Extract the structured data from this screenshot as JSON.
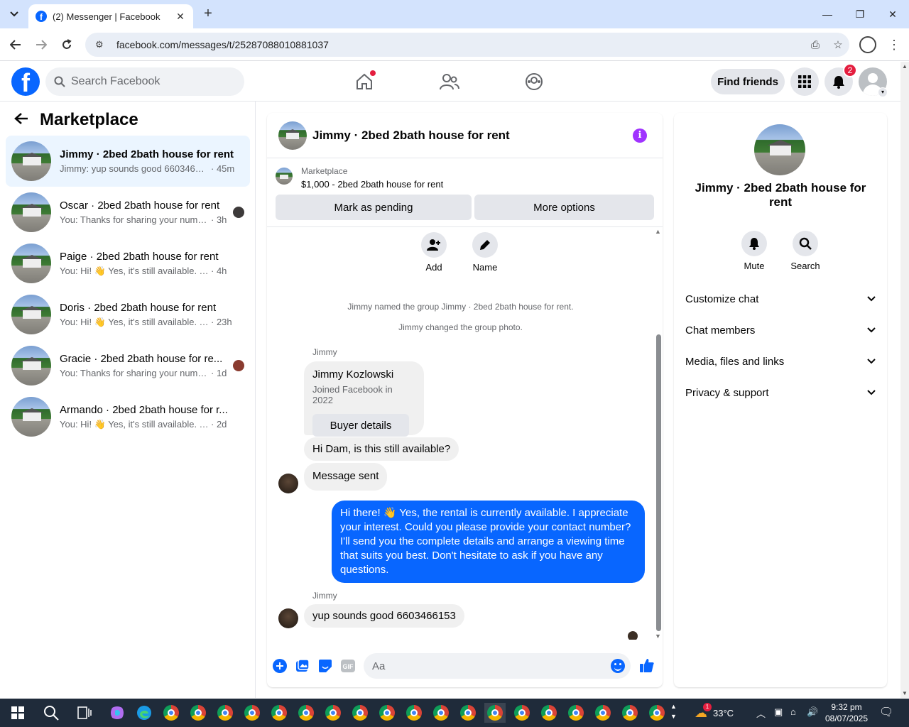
{
  "browser": {
    "tab_title": "(2) Messenger | Facebook",
    "url": "facebook.com/messages/t/25287088010881037"
  },
  "fb": {
    "search_placeholder": "Search Facebook",
    "find_friends": "Find friends",
    "notification_count": "2"
  },
  "left": {
    "title": "Marketplace",
    "conversations": [
      {
        "name": "Jimmy · 2bed 2bath house for rent",
        "snippet": "Jimmy: yup sounds good 66034661...",
        "time": "· 45m",
        "active": true
      },
      {
        "name": "Oscar · 2bed 2bath house for rent",
        "snippet": "You: Thanks for sharing your numb...",
        "time": "· 3h"
      },
      {
        "name": "Paige · 2bed 2bath house for rent",
        "snippet": "You: Hi! 👋 Yes, it's still available. Tha...",
        "time": "· 4h"
      },
      {
        "name": "Doris · 2bed 2bath house for rent",
        "snippet": "You: Hi! 👋 Yes, it's still available. Th...",
        "time": "· 23h"
      },
      {
        "name": "Gracie · 2bed 2bath house for re...",
        "snippet": "You: Thanks for sharing your numb...",
        "time": "· 1d"
      },
      {
        "name": "Armando · 2bed 2bath house for r...",
        "snippet": "You: Hi! 👋 Yes, it's still available. Tha...",
        "time": "· 2d"
      }
    ]
  },
  "chat": {
    "title": "Jimmy · 2bed 2bath house for rent",
    "marketplace_label": "Marketplace",
    "listing": "$1,000 - 2bed 2bath house for rent",
    "mark_pending": "Mark as pending",
    "more_options": "More options",
    "add_label": "Add",
    "name_label": "Name",
    "sys1": "Jimmy named the group Jimmy · 2bed 2bath house for rent.",
    "sys2": "Jimmy changed the group photo.",
    "sender": "Jimmy",
    "card_name": "Jimmy Kozlowski",
    "card_joined": "Joined Facebook in 2022",
    "buyer_details": "Buyer details",
    "msg1": "Hi Dam, is this still available?",
    "msg2": "Message sent",
    "msg_out": "Hi there! 👋 Yes, the rental is currently available. I appreciate your interest. Could you please provide your contact number? I'll send you the complete details and arrange a viewing time that suits you best. Don't hesitate to ask if you have any questions.",
    "sender2": "Jimmy",
    "msg3": "yup sounds good 6603466153",
    "composer_placeholder": "Aa"
  },
  "right": {
    "title": "Jimmy · 2bed 2bath house for rent",
    "mute": "Mute",
    "search": "Search",
    "sections": [
      "Customize chat",
      "Chat members",
      "Media, files and links",
      "Privacy & support"
    ]
  },
  "taskbar": {
    "temp": "33°C",
    "time": "9:32 pm",
    "date": "08/07/2025",
    "weather_badge": "1"
  },
  "colors": {
    "accent": "#0866ff",
    "info_purple": "#a033ff",
    "badge_red": "#e41e3f",
    "active_row": "#ebf5ff"
  }
}
